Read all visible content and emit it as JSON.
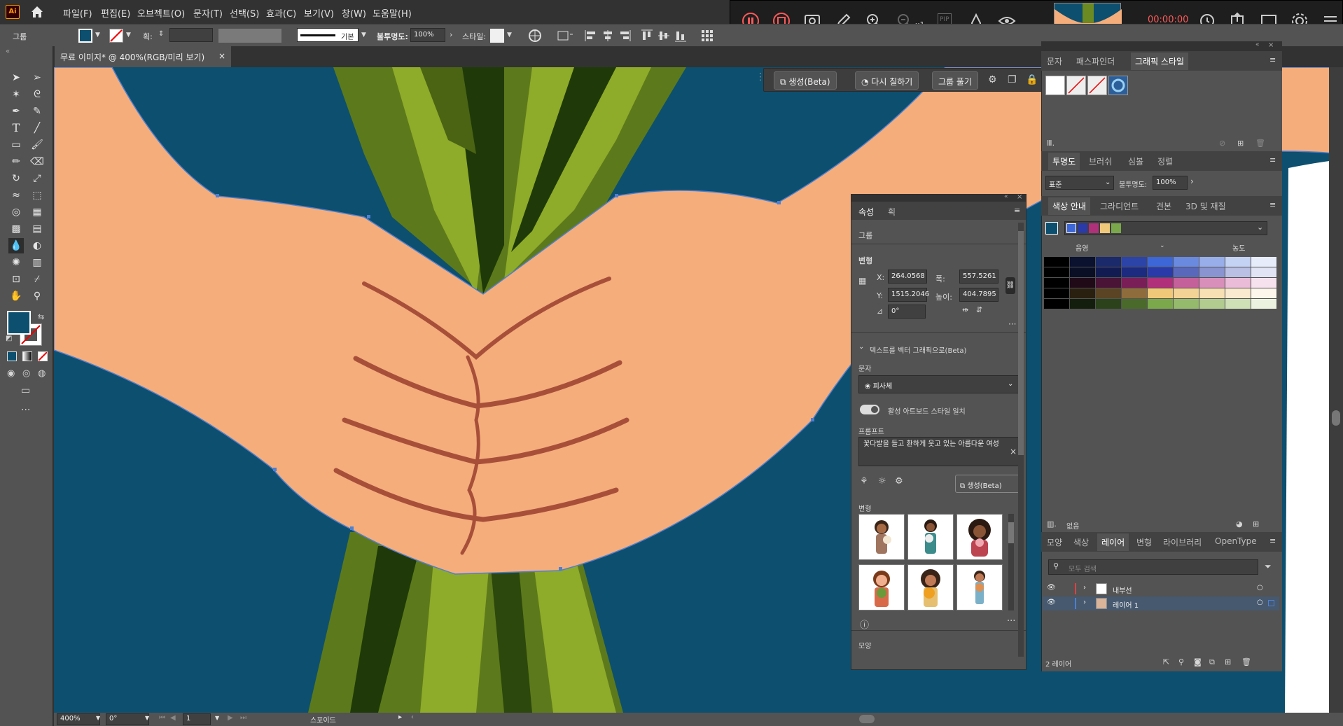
{
  "app": {
    "logo": "Ai"
  },
  "menu": [
    "파일(F)",
    "편집(E)",
    "오브젝트(O)",
    "문자(T)",
    "선택(S)",
    "효과(C)",
    "보기(V)",
    "창(W)",
    "도움말(H)"
  ],
  "options": {
    "group_label": "그룹",
    "stroke_label": "획:",
    "stroke_style": "기본",
    "opacity_label": "불투명도:",
    "opacity": "100%",
    "style_label": "스타일:"
  },
  "document": {
    "tab_title": "무료 이미지* @ 400%(RGB/미리 보기)",
    "close": "×"
  },
  "recorder": {
    "zoom_suffix": "x1",
    "pip": "PIP",
    "timer": "00:00:00"
  },
  "context_bar": {
    "generate": "생성(Beta)",
    "recolor": "다시 칠하기",
    "ungroup": "그룹 풀기"
  },
  "status": {
    "zoom": "400%",
    "angle": "0°",
    "artboard": "1",
    "tool": "스포이드"
  },
  "properties": {
    "tabs": [
      "속성",
      "획"
    ],
    "group": "그룹",
    "transform_label": "변형",
    "x_label": "X:",
    "x": "264.0568",
    "y_label": "Y:",
    "y": "1515.2046",
    "w_label": "폭:",
    "w": "557.5261",
    "h_label": "높이:",
    "h": "404.7895",
    "angle": "0°",
    "section": "텍스트를 벡터 그래픽으로(Beta)",
    "type_label": "문자",
    "type_value": "피사체",
    "toggle_label": "활성 아트보드 스타일 일치",
    "prompt_label": "프롬프트",
    "prompt": "꽃다발을 들고 환하게 웃고 있는 아름다운 여성",
    "generate_btn": "생성(Beta)",
    "variations_label": "변형",
    "appearance_label": "모양"
  },
  "right_panels": {
    "graphic_tabs": [
      "문자",
      "패스파인더",
      "그래픽 스타일"
    ],
    "transparency_tabs": [
      "투명도",
      "브러쉬",
      "심볼",
      "정렬"
    ],
    "blend_mode": "표준",
    "opacity_label": "불투명도:",
    "opacity": "100%",
    "color_guide_tabs": [
      "색상 안내",
      "그라디언트",
      "견본",
      "3D 및 재질"
    ],
    "shade_label": "음영",
    "tint_label": "농도",
    "color_guide_footer": "없음",
    "layers_tabs": [
      "모양",
      "색상",
      "레이어",
      "변형",
      "라이브러리",
      "OpenType"
    ],
    "search_placeholder": "모두 검색",
    "layers": [
      "내부선",
      "레이어 1"
    ],
    "layer_count": "2 레이어"
  },
  "colors": {
    "canvas_bg": "#0d4f6f",
    "skin": "#f4ad7b",
    "line": "#a84f3a",
    "leaf_dark": "#5c7a1b",
    "leaf_light": "#8eab2a",
    "accent": "#0f5a7d"
  }
}
